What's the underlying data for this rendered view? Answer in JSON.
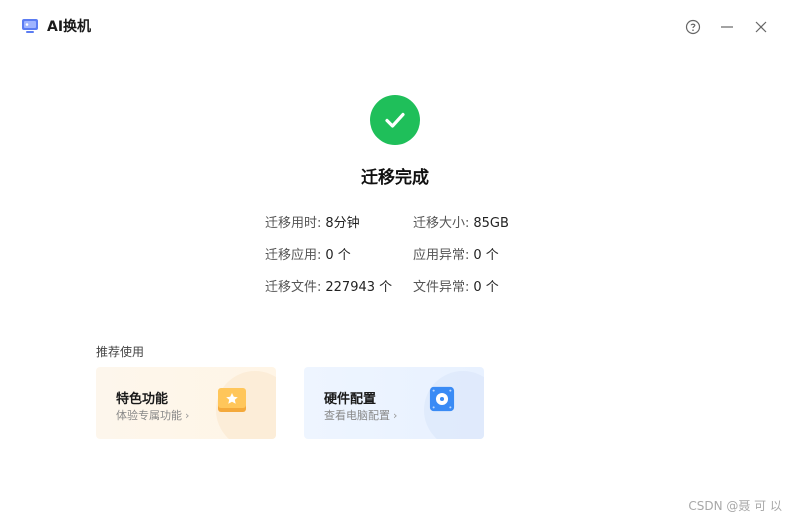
{
  "window": {
    "title": "AI换机",
    "icon": "app-monitor-icon",
    "controls": [
      "help-icon",
      "minimize-icon",
      "close-icon"
    ]
  },
  "result": {
    "icon": "success-check-icon",
    "title": "迁移完成",
    "color": "#1fbf5a"
  },
  "stats": {
    "rows": [
      {
        "label": "迁移用时:",
        "value": "8分钟"
      },
      {
        "label": "迁移大小:",
        "value": "85GB"
      },
      {
        "label": "迁移应用:",
        "value": "0 个"
      },
      {
        "label": "应用异常:",
        "value": "0 个"
      },
      {
        "label": "迁移文件:",
        "value": "227943 个"
      },
      {
        "label": "文件异常:",
        "value": "0 个"
      }
    ]
  },
  "recommend": {
    "title": "推荐使用",
    "cards": [
      {
        "title": "特色功能",
        "subtitle": "体验专属功能",
        "icon": "star-folder-icon"
      },
      {
        "title": "硬件配置",
        "subtitle": "查看电脑配置",
        "icon": "hardware-disk-icon"
      }
    ]
  },
  "watermark": "CSDN @聂 可 以"
}
